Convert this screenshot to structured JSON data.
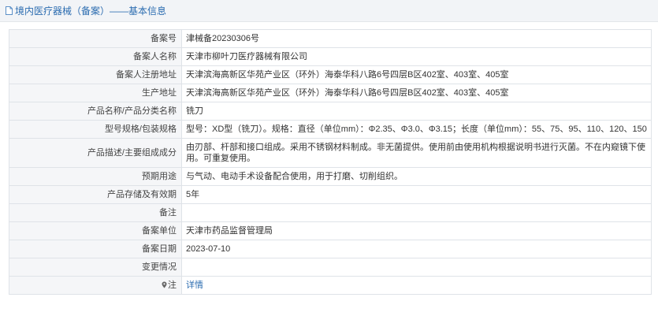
{
  "header": {
    "title": "境内医疗器械（备案）——基本信息",
    "icon": "document-icon"
  },
  "rows": [
    {
      "label": "备案号",
      "value": "津械备20230306号"
    },
    {
      "label": "备案人名称",
      "value": "天津市柳叶刀医疗器械有限公司"
    },
    {
      "label": "备案人注册地址",
      "value": "天津滨海高新区华苑产业区（环外）海泰华科八路6号四层B区402室、403室、405室"
    },
    {
      "label": "生产地址",
      "value": "天津滨海高新区华苑产业区（环外）海泰华科八路6号四层B区402室、403室、405室"
    },
    {
      "label": "产品名称/产品分类名称",
      "value": "铣刀"
    },
    {
      "label": "型号规格/包装规格",
      "value": "型号：XD型（铣刀）。规格：直径（单位mm）：Φ2.35、Φ3.0、Φ3.15；长度（单位mm）：55、75、95、110、120、150"
    },
    {
      "label": "产品描述/主要组成成分",
      "value": "由刃部、杆部和接口组成。采用不锈钢材料制成。非无菌提供。使用前由使用机构根据说明书进行灭菌。不在内窥镜下使用。可重复使用。"
    },
    {
      "label": "预期用途",
      "value": "与气动、电动手术设备配合使用，用于打磨、切削组织。"
    },
    {
      "label": "产品存储及有效期",
      "value": "5年"
    },
    {
      "label": "备注",
      "value": ""
    },
    {
      "label": "备案单位",
      "value": "天津市药品监督管理局"
    },
    {
      "label": "备案日期",
      "value": "2023-07-10"
    },
    {
      "label": "变更情况",
      "value": ""
    },
    {
      "label": "注",
      "value": "详情",
      "icon": "pin-icon"
    }
  ]
}
